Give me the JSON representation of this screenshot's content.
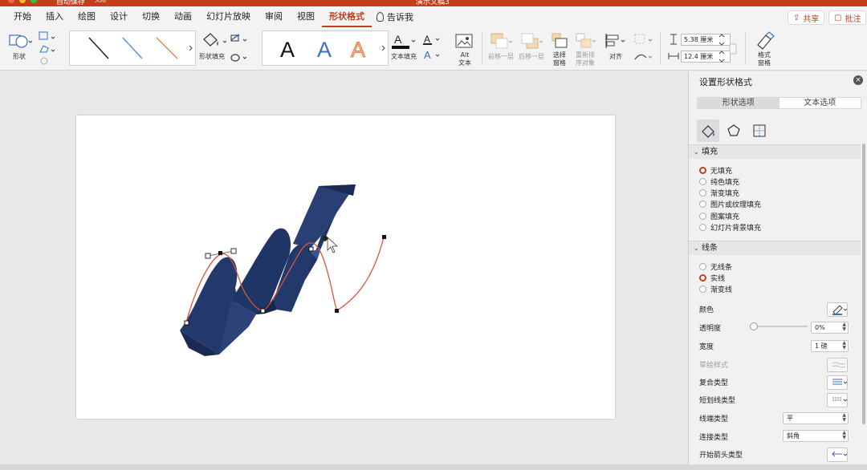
{
  "window": {
    "autosave_label": "自动保存",
    "autosave_state": "关闭",
    "document_title": "演示文稿3",
    "colors": {
      "brand": "#c43e1c",
      "close": "#ff5f57",
      "minimize": "#febc2e",
      "zoom": "#28c840"
    }
  },
  "ribbon_tabs": [
    {
      "label": "开始"
    },
    {
      "label": "插入"
    },
    {
      "label": "绘图"
    },
    {
      "label": "设计"
    },
    {
      "label": "切换"
    },
    {
      "label": "动画"
    },
    {
      "label": "幻灯片放映"
    },
    {
      "label": "审阅"
    },
    {
      "label": "视图"
    },
    {
      "label": "形状格式",
      "active": true
    }
  ],
  "tell_me": "告诉我",
  "share_label": "共享",
  "comments_label": "批注",
  "ribbon": {
    "shape_label": "形状",
    "shape_fill_label": "形状填充",
    "text_fill_label": "文本填充",
    "alt_text_label": "Alt\n文本",
    "bring_forward_label": "前移一层",
    "send_backward_label": "后移一层",
    "selection_pane_label": "选择\n窗格",
    "reorder_label": "重新排\n序对象",
    "align_label": "对齐",
    "height_value": "5.38 厘米",
    "width_value": "12.4 厘米",
    "format_pane_label": "格式\n窗格",
    "line_style_colors": [
      "#222222",
      "#5b8fd6",
      "#e3864f"
    ],
    "wordart_colors": [
      "#111111",
      "#3b6fc4",
      "#e3864f"
    ]
  },
  "pane": {
    "title": "设置形状格式",
    "tab_shape": "形状选项",
    "tab_text": "文本选项",
    "fill_section": "填充",
    "fill_options": [
      {
        "label": "无填充",
        "selected": true
      },
      {
        "label": "纯色填充",
        "selected": false
      },
      {
        "label": "渐变填充",
        "selected": false
      },
      {
        "label": "图片或纹理填充",
        "selected": false
      },
      {
        "label": "图案填充",
        "selected": false
      },
      {
        "label": "幻灯片背景填充",
        "selected": false
      }
    ],
    "line_section": "线条",
    "line_options": [
      {
        "label": "无线条",
        "selected": false
      },
      {
        "label": "实线",
        "selected": true
      },
      {
        "label": "渐变线",
        "selected": false
      }
    ],
    "color_label": "颜色",
    "transparency_label": "透明度",
    "transparency_value": "0%",
    "width_label": "宽度",
    "width_value": "1 磅",
    "sketch_label": "草绘样式",
    "compound_label": "复合类型",
    "dash_label": "短划线类型",
    "cap_label": "线端类型",
    "cap_value": "平",
    "join_label": "连接类型",
    "join_value": "斜角",
    "arrow_label": "开始箭头类型"
  },
  "slide": {
    "ribbon_color": "#1f3566",
    "curve_color": "#d9543b"
  }
}
